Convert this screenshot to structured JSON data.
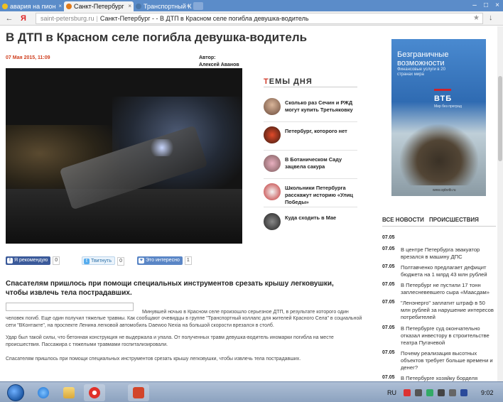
{
  "browser": {
    "tabs": [
      {
        "label": "авария на пион"
      },
      {
        "label": "Санкт-Петербург"
      },
      {
        "label": "Транспортный К"
      }
    ],
    "url_domain": "saint-petersburg.ru",
    "url_title": "Санкт-Петербург - - В ДТП в Красном селе погибла девушка-водитель",
    "back_glyph": "←",
    "yandex_glyph": "Я",
    "star_glyph": "★",
    "download_glyph": "↓",
    "tab_close_glyph": "×",
    "minimize_glyph": "–",
    "maximize_glyph": "□",
    "close_glyph": "×"
  },
  "article": {
    "headline": "В ДТП в Красном селе погибла девушка-водитель",
    "date": "07 Мая 2015, 11:09",
    "author_label": "Автор:",
    "author_name": "Алексей Аванов",
    "share": {
      "fb_label": "Я рекомендую",
      "fb_count": "0",
      "tw_label": "Твитнуть",
      "tw_count": "0",
      "int_label": "Это интересно",
      "int_count": "1"
    },
    "lead": "Спасателям пришлось при помощи специальных инструментов срезать крышу легковушки, чтобы извлечь тела пострадавших.",
    "para1_start": "Минувшей ночью в Красном селе произошло серьезное ДТП, в результате которого один",
    "para1": "человек погиб. Еще один получил тяжелые травмы. Как сообщают очевидцы в группе \"Транспортный коллапс для жителей Красного Села\" в социальной сети \"ВКонтакте\", на проспекте Ленина легковой автомобиль Daewoo Nexia на большой скорости врезался в столб.",
    "para2": "Удар был такой силы, что бетонная конструкция не выдержала и упала. От полученных травм девушка-водитель иномарки погибла на месте происшествия. Пассажира с тяжелыми травмами госпитализировали.",
    "para3": "Спасателям пришлось при помощи специальных инструментов срезать крышу легковушки, чтобы извлечь тела пострадавших."
  },
  "topics": {
    "title_first": "Т",
    "title_rest": "ЕМЫ ДНЯ",
    "items": [
      {
        "text": "Сколько раз Сечин и РЖД могут купить Третьяковку",
        "icon": "person-thumb-icon"
      },
      {
        "text": "Петербург, которого нет",
        "icon": "city-thumb-icon"
      },
      {
        "text": "В Ботаническом Саду зацвела сакура",
        "icon": "sakura-thumb-icon"
      },
      {
        "text": "Школьники Петербурга расскажут историю «Улиц Победы»",
        "icon": "children-thumb-icon"
      },
      {
        "text": "Куда сходить в Мае",
        "icon": "event-thumb-icon"
      }
    ]
  },
  "ad": {
    "headline": "Безграничные возможности",
    "subline": "Финансовые услуги в 20 странах мира",
    "logo": "ВТБ",
    "logo_sub": "Мир без преград",
    "url": "www.spbvtb.ru"
  },
  "news": {
    "tab_all": "ВСЕ НОВОСТИ",
    "tab_incidents": "ПРОИСШЕСТВИЯ",
    "items": [
      {
        "time": "07.05",
        "title": ""
      },
      {
        "time": "07.05",
        "title": "В центре Петербурга эвакуатор врезался в машину ДПС"
      },
      {
        "time": "07.05",
        "title": "Полтавченко предлагает дефицит бюджета на 1 млрд 43 млн рублей"
      },
      {
        "time": "07.05",
        "title": "В Петербург не пустили 17 тонн заплесневевшего сыра «Маасдам»"
      },
      {
        "time": "07.05",
        "title": "\"Ленэнерго\" заплатит штраф в 50 млн рублей за нарушение интересов потребителей"
      },
      {
        "time": "07.05",
        "title": "В Петербурге суд окончательно отказал инвестору в строительстве театра Пугачевой"
      },
      {
        "time": "07.05",
        "title": "Почему реализация высотных объектов требует больше времени и денег?"
      },
      {
        "time": "07.05",
        "title": "В Петербурге хозяйку борделя"
      }
    ]
  },
  "taskbar": {
    "lang": "RU",
    "time": "9:02"
  },
  "colors": {
    "accent_red": "#d03a2a",
    "tab_bar": "#5b8cc9",
    "fb_blue": "#3b5a9a",
    "vtb_blue": "#2f6bb2"
  }
}
